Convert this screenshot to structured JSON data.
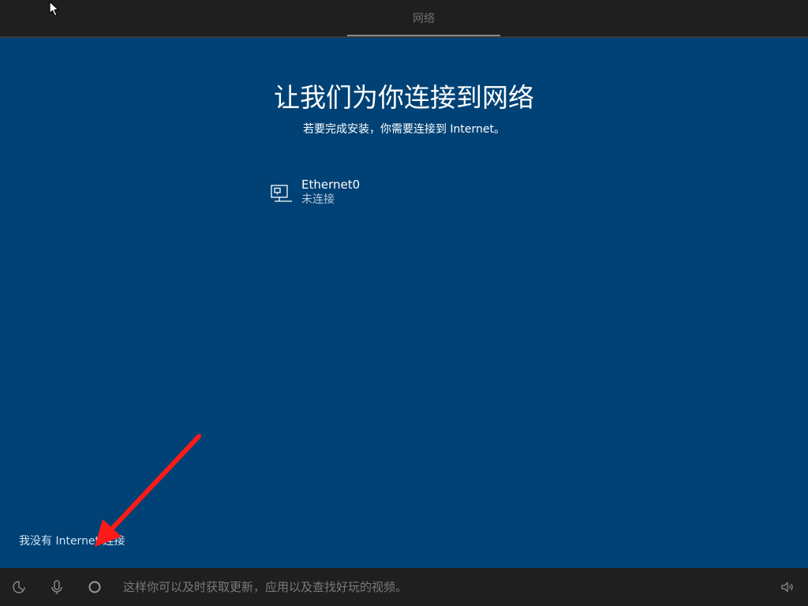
{
  "top_bar": {
    "tab_label": "网络"
  },
  "main": {
    "title": "让我们为你连接到网络",
    "subtitle": "若要完成安装，你需要连接到 Internet。",
    "networks": [
      {
        "name": "Ethernet0",
        "status": "未连接",
        "icon": "ethernet-icon"
      }
    ],
    "no_internet_link": "我没有 Internet 连接"
  },
  "taskbar": {
    "icons": [
      "ease-of-access-icon",
      "microphone-icon",
      "cortana-icon",
      "volume-icon"
    ],
    "cortana_text": "这样你可以及时获取更新，应用以及查找好玩的视频。"
  },
  "colors": {
    "background": "#004275",
    "bar": "#1f1f1f",
    "annotation_arrow": "#ff1a1a"
  }
}
